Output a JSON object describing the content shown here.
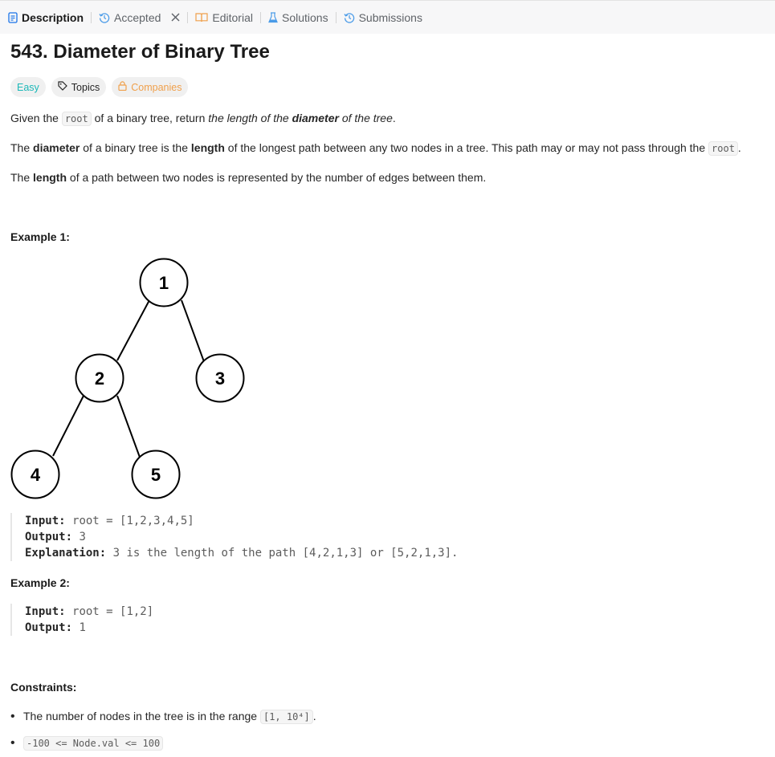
{
  "tabs": [
    {
      "label": "Description",
      "icon": "description-icon"
    },
    {
      "label": "Accepted",
      "icon": "history-icon"
    },
    {
      "label": "Editorial",
      "icon": "book-icon"
    },
    {
      "label": "Solutions",
      "icon": "flask-icon"
    },
    {
      "label": "Submissions",
      "icon": "history-icon"
    }
  ],
  "title": "543. Diameter of Binary Tree",
  "tags": {
    "difficulty": "Easy",
    "topics": "Topics",
    "companies": "Companies"
  },
  "colors": {
    "easy": "#1cb8b8",
    "companies": "#f0a04b",
    "accent_tab": "#1a73e8"
  },
  "description": {
    "p1": {
      "a": "Given the ",
      "code": "root",
      "b": " of a binary tree, return ",
      "i1": "the length of the ",
      "bi": "diameter",
      "i2": " of the tree",
      "end": "."
    },
    "p2": {
      "a": "The ",
      "b1": "diameter",
      "c": " of a binary tree is the ",
      "b2": "length",
      "d": " of the longest path between any two nodes in a tree. This path may or may not pass through the ",
      "code": "root",
      "end": "."
    },
    "p3": {
      "a": "The ",
      "b": "length",
      "c": " of a path between two nodes is represented by the number of edges between them."
    }
  },
  "example1": {
    "heading": "Example 1:",
    "tree": {
      "nodes": [
        "1",
        "2",
        "3",
        "4",
        "5"
      ]
    },
    "input_label": "Input:",
    "input": "root = [1,2,3,4,5]",
    "output_label": "Output:",
    "output": "3",
    "explanation_label": "Explanation:",
    "explanation": "3 is the length of the path [4,2,1,3] or [5,2,1,3]."
  },
  "example2": {
    "heading": "Example 2:",
    "input_label": "Input:",
    "input": "root = [1,2]",
    "output_label": "Output:",
    "output": "1"
  },
  "constraints": {
    "heading": "Constraints:",
    "c1": {
      "text": "The number of nodes in the tree is in the range ",
      "code": "[1, 10⁴]",
      "end": "."
    },
    "c2": {
      "code": "-100 <= Node.val <= 100"
    }
  }
}
